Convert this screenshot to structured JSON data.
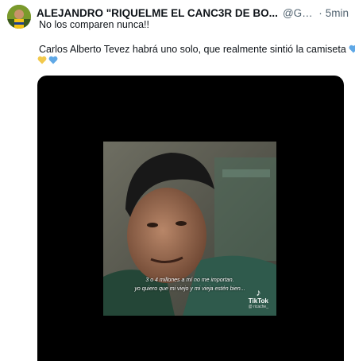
{
  "tweet": {
    "author_name": "ALEJANDRO \"RIQUELME EL CANC3R DE BO...",
    "handle": "@Garnachist...",
    "separator": "·",
    "time": "5min",
    "line1": "No los comparen nunca!!",
    "line2": "Carlos Alberto Tevez habrá uno solo, que realmente sintió la camiseta",
    "emoji_names": [
      "blue-heart-icon",
      "yellow-heart-icon",
      "blue-heart-icon"
    ],
    "colors": {
      "blue_heart": "#5fa8e6",
      "yellow_heart": "#f2c94c",
      "secondary_text": "#536471"
    }
  },
  "video": {
    "caption_line1": "3 o 4 millones a mí no me importan.",
    "caption_line2": "yo quiero que mi viejo y mi vieja estén bien...",
    "watermark_logo": "TikTok",
    "watermark_user": "@ ricache_"
  }
}
